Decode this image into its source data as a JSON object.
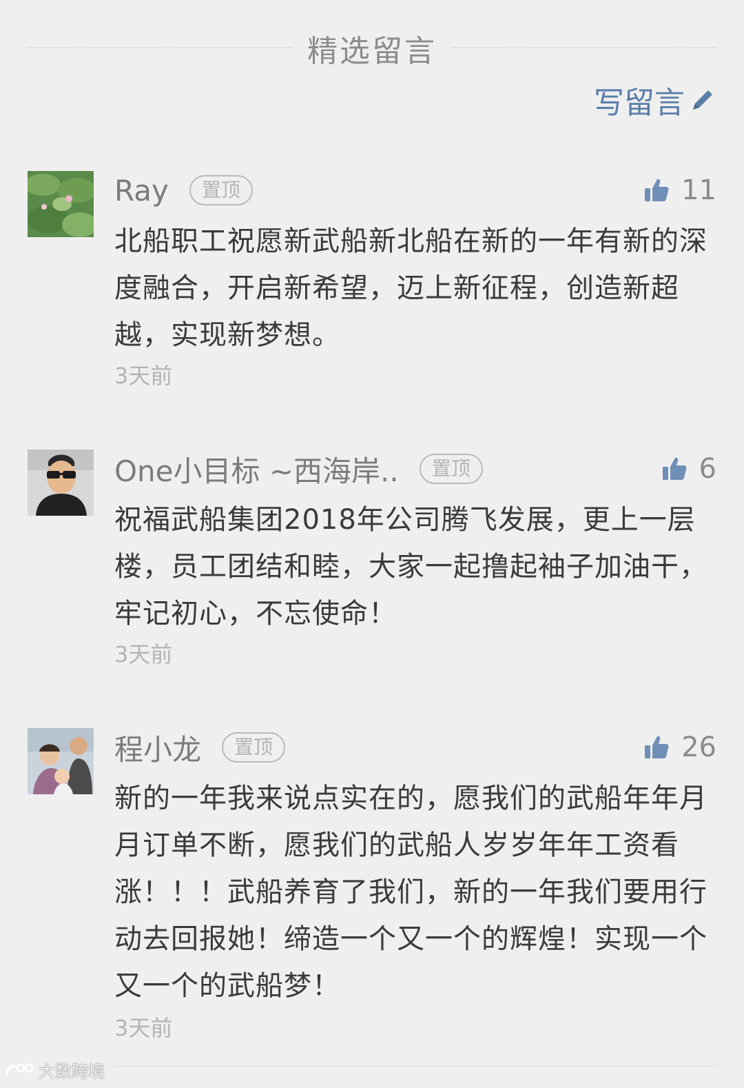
{
  "header": {
    "section_title": "精选留言",
    "write_comment_label": "写留言"
  },
  "comments": [
    {
      "nickname": "Ray",
      "pin_label": "置顶",
      "likes": "11",
      "text": "北船职工祝愿新武船新北船在新的一年有新的深度融合，开启新希望，迈上新征程，创造新超越，实现新梦想。",
      "time": "3天前"
    },
    {
      "nickname": "One小目标 ~西海岸..",
      "pin_label": "置顶",
      "likes": "6",
      "text": "祝福武船集团2018年公司腾飞发展，更上一层楼，员工团结和睦，大家一起撸起袖子加油干，牢记初心，不忘使命！",
      "time": "3天前"
    },
    {
      "nickname": "程小龙",
      "pin_label": "置顶",
      "likes": "26",
      "text": "新的一年我来说点实在的，愿我们的武船年年月月订单不断，愿我们的武船人岁岁年年工资看涨！！！武船养育了我们，新的一年我们要用行动去回报她！缔造一个又一个的辉煌！实现一个又一个的武船梦！",
      "time": "3天前"
    }
  ],
  "watermark": "大数跨境",
  "colors": {
    "background": "#efefef",
    "accent": "#5a7ea8",
    "thumb": "#6f8fb7"
  },
  "icons": {
    "write": "pencil-icon",
    "like": "thumbs-up-icon"
  }
}
